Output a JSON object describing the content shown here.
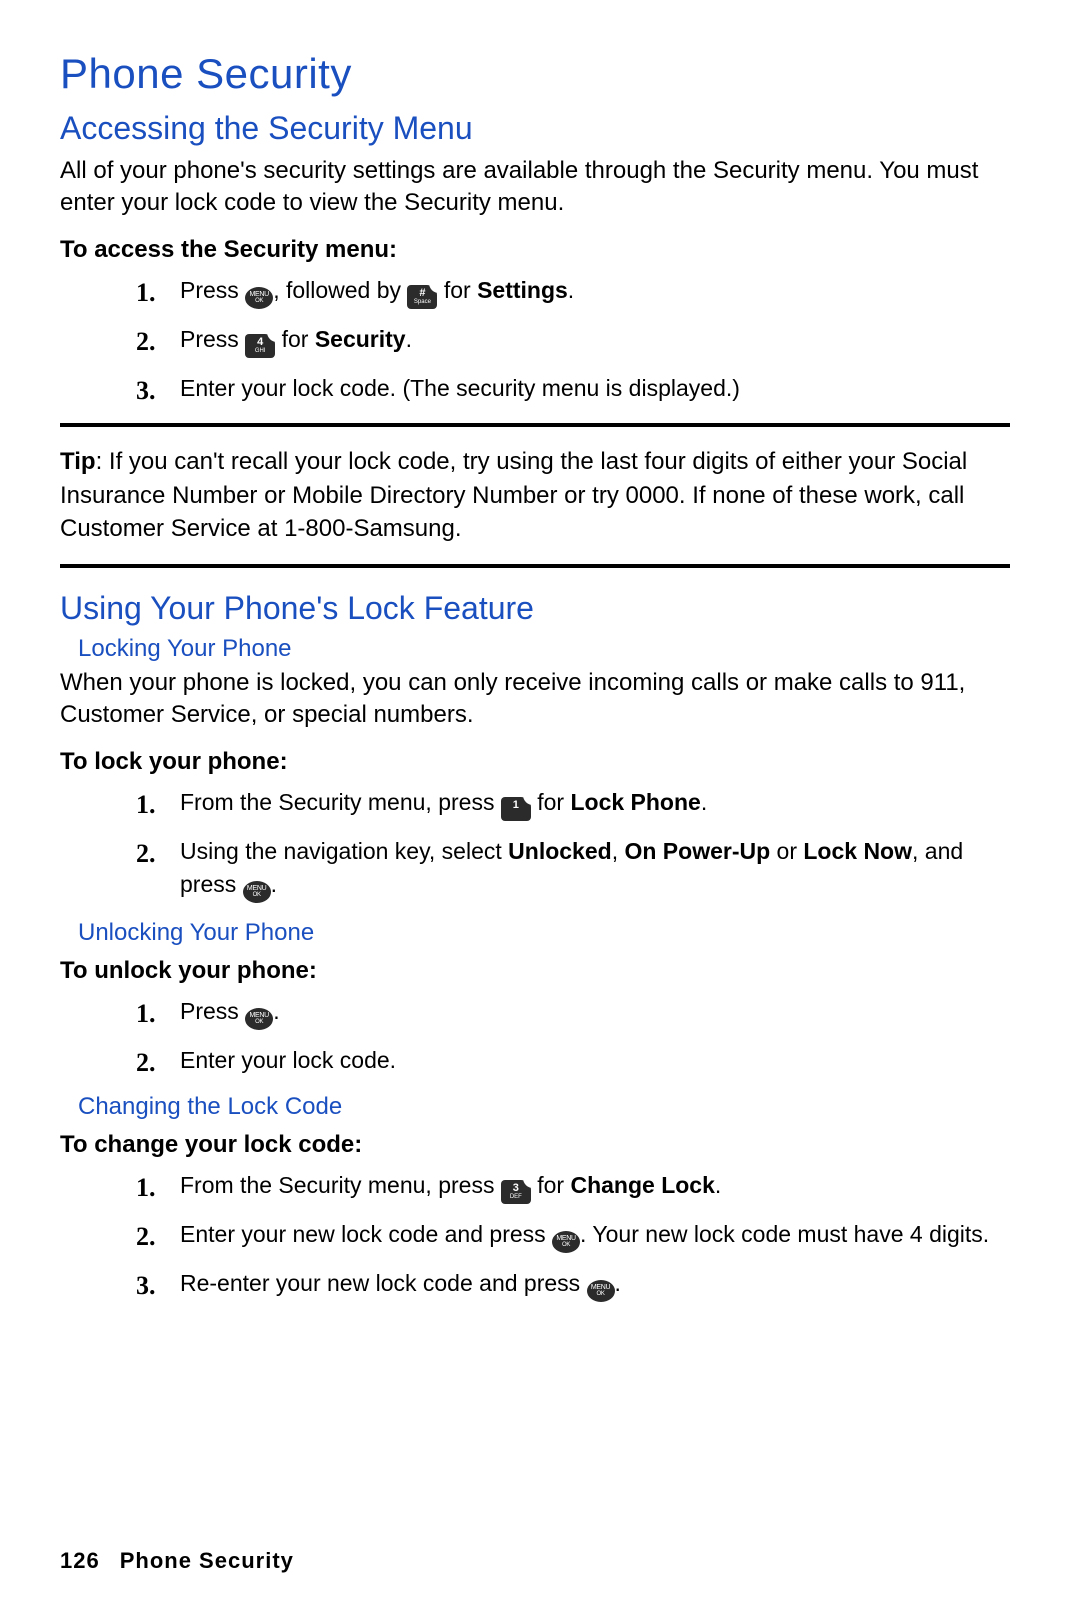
{
  "title": "Phone Security",
  "sec1": {
    "heading": "Accessing the Security Menu",
    "intro": "All of your phone's security settings are available through the Security menu. You must enter your lock code to view the Security menu.",
    "lead": "To access the Security menu:",
    "steps": {
      "s1a": "Press ",
      "s1b": ", followed by ",
      "s1c": " for ",
      "s1d": "Settings",
      "s2a": "Press ",
      "s2b": " for ",
      "s2c": "Security",
      "s3": "Enter your lock code. (The security menu is displayed.)"
    }
  },
  "tip": {
    "label": "Tip",
    "body": ": If you can't recall your lock code, try using the last four digits of either your Social Insurance Number or Mobile Directory Number or try 0000. If none of these work, call Customer Service at 1-800-Samsung."
  },
  "sec2": {
    "heading": "Using Your Phone's Lock Feature",
    "sub1": "Locking Your Phone",
    "sub1_body": "When your phone is locked, you can only receive incoming calls or make calls to 911, Customer Service, or special numbers.",
    "lead1": "To lock your phone:",
    "lock": {
      "s1a": "From the Security menu, press ",
      "s1b": " for ",
      "s1c": "Lock Phone",
      "s2a": "Using the navigation key, select ",
      "s2b": "Unlocked",
      "s2c": ", ",
      "s2d": "On Power-Up",
      "s2e": " or ",
      "s2f": "Lock Now",
      "s2g": ", and press ",
      "s2h": "."
    },
    "sub2": "Unlocking Your Phone",
    "lead2": "To unlock your phone:",
    "unlock": {
      "s1a": "Press ",
      "s1b": ".",
      "s2": "Enter your lock code."
    },
    "sub3": "Changing the Lock Code",
    "lead3": "To change your lock code:",
    "change": {
      "s1a": "From the Security menu, press ",
      "s1b": " for ",
      "s1c": "Change Lock",
      "s2a": "Enter your new lock code and press ",
      "s2b": ". Your new lock code must have 4 digits.",
      "s3a": "Re-enter your new lock code and press ",
      "s3b": "."
    }
  },
  "keys": {
    "menu": "MENU\nOK",
    "hash": "#",
    "one": "1",
    "three": "3",
    "four": "4"
  },
  "footer": {
    "page": "126",
    "title": "Phone Security"
  }
}
